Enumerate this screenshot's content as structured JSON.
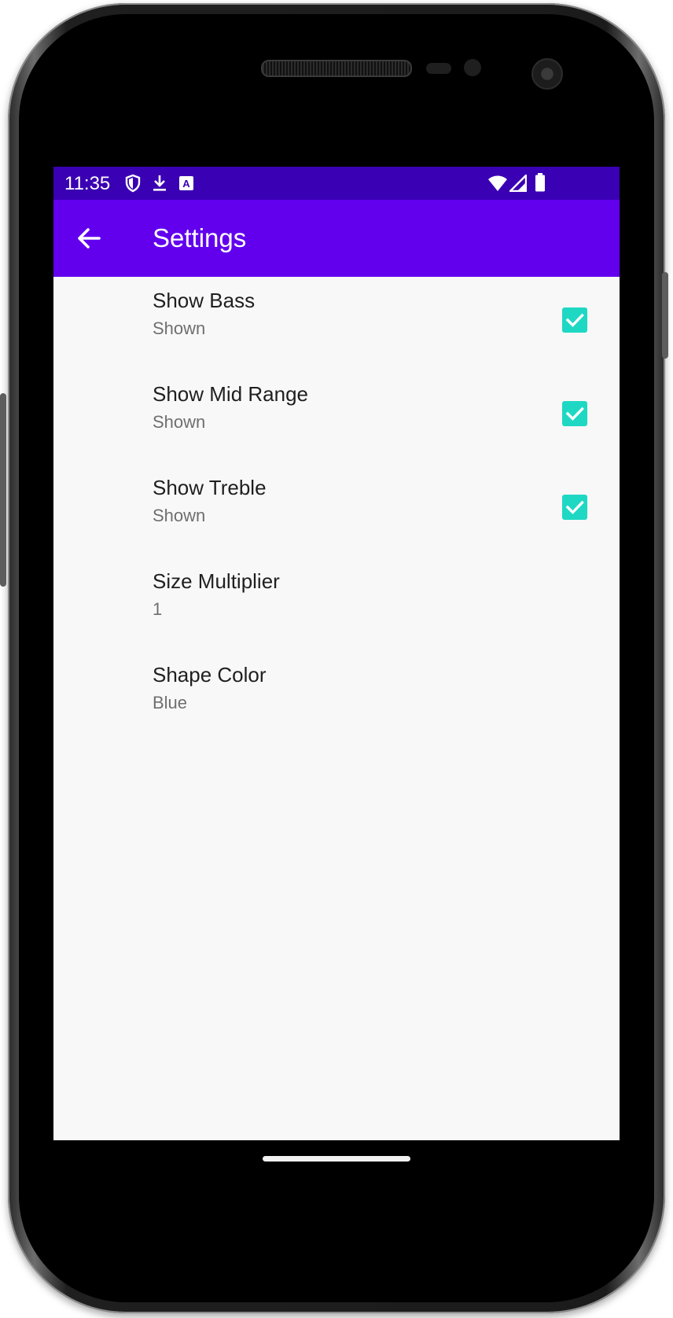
{
  "status_bar": {
    "time": "11:35",
    "icons_left": [
      "shield-icon",
      "download-icon",
      "font-a-icon"
    ],
    "icons_right": [
      "wifi-icon",
      "cell-signal-icon",
      "battery-icon"
    ],
    "color": "#3a00b3"
  },
  "app_bar": {
    "title": "Settings",
    "color": "#6200ee",
    "back_icon": "arrow-left-icon"
  },
  "accent": "#1ed8c4",
  "preferences": [
    {
      "title": "Show Bass",
      "summary": "Shown",
      "checked": true
    },
    {
      "title": "Show Mid Range",
      "summary": "Shown",
      "checked": true
    },
    {
      "title": "Show Treble",
      "summary": "Shown",
      "checked": true
    },
    {
      "title": "Size Multiplier",
      "summary": "1"
    },
    {
      "title": "Shape Color",
      "summary": "Blue"
    }
  ]
}
